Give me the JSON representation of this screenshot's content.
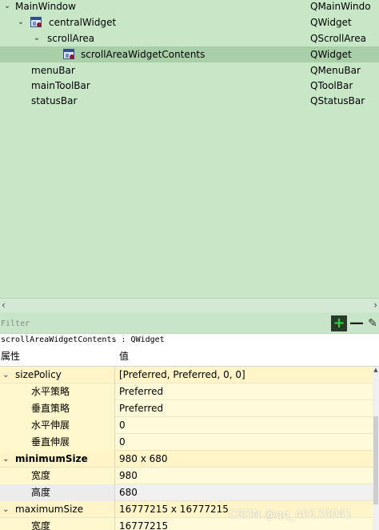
{
  "tree": {
    "rows": [
      {
        "name": "MainWindow",
        "class": "QMainWindo"
      },
      {
        "name": "centralWidget",
        "class": "QWidget"
      },
      {
        "name": "scrollArea",
        "class": "QScrollArea"
      },
      {
        "name": "scrollAreaWidgetContents",
        "class": "QWidget"
      },
      {
        "name": "menuBar",
        "class": "QMenuBar"
      },
      {
        "name": "mainToolBar",
        "class": "QToolBar"
      },
      {
        "name": "statusBar",
        "class": "QStatusBar"
      }
    ]
  },
  "filter": {
    "placeholder": "Filter"
  },
  "object_header": "scrollAreaWidgetContents : QWidget",
  "property_editor": {
    "header": {
      "property": "属性",
      "value": "值"
    },
    "rows": [
      {
        "name": "sizePolicy",
        "value": "[Preferred, Preferred, 0, 0]"
      },
      {
        "name": "水平策略",
        "value": "Preferred"
      },
      {
        "name": "垂直策略",
        "value": "Preferred"
      },
      {
        "name": "水平伸展",
        "value": "0"
      },
      {
        "name": "垂直伸展",
        "value": "0"
      },
      {
        "name": "minimumSize",
        "value": "980 x 680"
      },
      {
        "name": "宽度",
        "value": "980"
      },
      {
        "name": "高度",
        "value": "680"
      },
      {
        "name": "maximumSize",
        "value": "16777215 x 16777215"
      },
      {
        "name": "宽度",
        "value": "16777215"
      }
    ]
  },
  "watermark": "CSDN @qq_40170041",
  "colors": {
    "tree_bg": "#c7e7c7",
    "selected_row": "#a9cfa9",
    "property_group": "#fff5c8",
    "property_child": "#fffbd9",
    "add_icon": "#27d83a"
  }
}
